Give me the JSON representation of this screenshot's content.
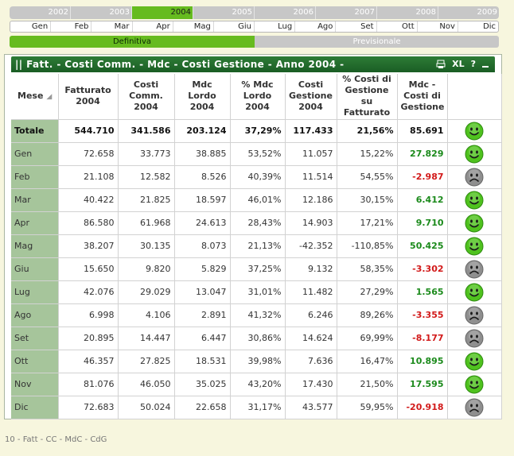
{
  "years": [
    "2002",
    "2003",
    "2004",
    "2005",
    "2006",
    "2007",
    "2008",
    "2009"
  ],
  "active_year": "2004",
  "months": [
    "Gen",
    "Feb",
    "Mar",
    "Apr",
    "Mag",
    "Giu",
    "Lug",
    "Ago",
    "Set",
    "Ott",
    "Nov",
    "Dic"
  ],
  "toggle": {
    "definitiva": "Definitiva",
    "previsionale": "Previsionale"
  },
  "panel": {
    "title": "|| Fatt. - Costi Comm. - Mdc - Costi Gestione - Anno 2004 -",
    "xl_label": "XL",
    "help_label": "?"
  },
  "columns": [
    "Mese",
    "Fatturato 2004",
    "Costi Comm. 2004",
    "Mdc Lordo 2004",
    "% Mdc Lordo 2004",
    "Costi Gestione 2004",
    "% Costi di Gestione su Fatturato",
    "Mdc - Costi di Gestione"
  ],
  "total": {
    "label": "Totale",
    "fatt": "544.710",
    "cc": "341.586",
    "mdc": "203.124",
    "pmdc": "37,29%",
    "cg": "117.433",
    "pcg": "21,56%",
    "res": "85.691",
    "sign": "pos"
  },
  "rows": [
    {
      "label": "Gen",
      "fatt": "72.658",
      "cc": "33.773",
      "mdc": "38.885",
      "pmdc": "53,52%",
      "cg": "11.057",
      "pcg": "15,22%",
      "res": "27.829",
      "sign": "pos"
    },
    {
      "label": "Feb",
      "fatt": "21.108",
      "cc": "12.582",
      "mdc": "8.526",
      "pmdc": "40,39%",
      "cg": "11.514",
      "pcg": "54,55%",
      "res": "-2.987",
      "sign": "neg"
    },
    {
      "label": "Mar",
      "fatt": "40.422",
      "cc": "21.825",
      "mdc": "18.597",
      "pmdc": "46,01%",
      "cg": "12.186",
      "pcg": "30,15%",
      "res": "6.412",
      "sign": "pos"
    },
    {
      "label": "Apr",
      "fatt": "86.580",
      "cc": "61.968",
      "mdc": "24.613",
      "pmdc": "28,43%",
      "cg": "14.903",
      "pcg": "17,21%",
      "res": "9.710",
      "sign": "pos"
    },
    {
      "label": "Mag",
      "fatt": "38.207",
      "cc": "30.135",
      "mdc": "8.073",
      "pmdc": "21,13%",
      "cg": "-42.352",
      "pcg": "-110,85%",
      "res": "50.425",
      "sign": "pos"
    },
    {
      "label": "Giu",
      "fatt": "15.650",
      "cc": "9.820",
      "mdc": "5.829",
      "pmdc": "37,25%",
      "cg": "9.132",
      "pcg": "58,35%",
      "res": "-3.302",
      "sign": "neg"
    },
    {
      "label": "Lug",
      "fatt": "42.076",
      "cc": "29.029",
      "mdc": "13.047",
      "pmdc": "31,01%",
      "cg": "11.482",
      "pcg": "27,29%",
      "res": "1.565",
      "sign": "pos"
    },
    {
      "label": "Ago",
      "fatt": "6.998",
      "cc": "4.106",
      "mdc": "2.891",
      "pmdc": "41,32%",
      "cg": "6.246",
      "pcg": "89,26%",
      "res": "-3.355",
      "sign": "neg"
    },
    {
      "label": "Set",
      "fatt": "20.895",
      "cc": "14.447",
      "mdc": "6.447",
      "pmdc": "30,86%",
      "cg": "14.624",
      "pcg": "69,99%",
      "res": "-8.177",
      "sign": "neg"
    },
    {
      "label": "Ott",
      "fatt": "46.357",
      "cc": "27.825",
      "mdc": "18.531",
      "pmdc": "39,98%",
      "cg": "7.636",
      "pcg": "16,47%",
      "res": "10.895",
      "sign": "pos"
    },
    {
      "label": "Nov",
      "fatt": "81.076",
      "cc": "46.050",
      "mdc": "35.025",
      "pmdc": "43,20%",
      "cg": "17.430",
      "pcg": "21,50%",
      "res": "17.595",
      "sign": "pos"
    },
    {
      "label": "Dic",
      "fatt": "72.683",
      "cc": "50.024",
      "mdc": "22.658",
      "pmdc": "31,17%",
      "cg": "43.577",
      "pcg": "59,95%",
      "res": "-20.918",
      "sign": "neg"
    }
  ],
  "colors": {
    "positive": "#1b8a1b",
    "negative": "#d21a1a",
    "happy_face": "#4fc21e",
    "sad_face": "#8f8f8f",
    "accent": "#66bb1f"
  },
  "footer": "10 - Fatt - CC - MdC - CdG"
}
